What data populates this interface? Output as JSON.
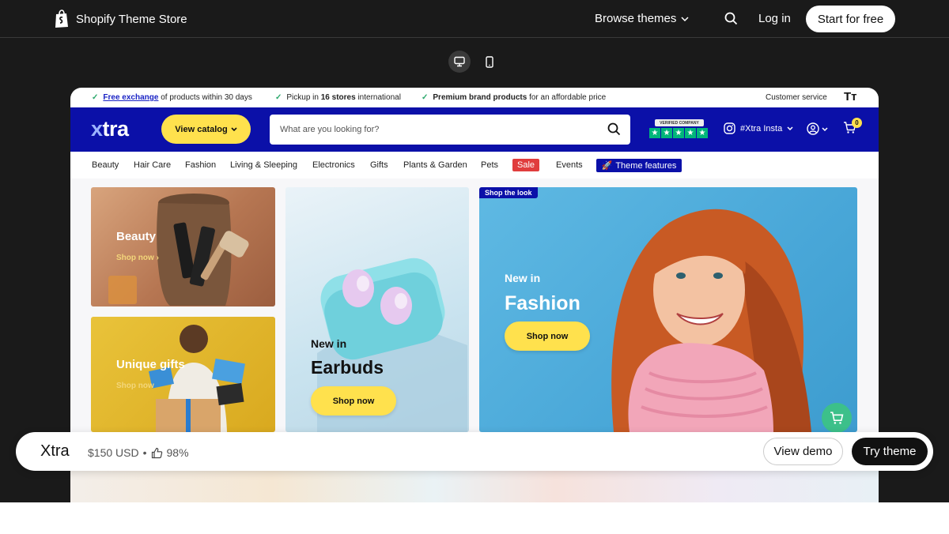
{
  "store": {
    "logo_text": "Shopify Theme Store",
    "browse_label": "Browse themes",
    "login_label": "Log in",
    "start_label": "Start for free"
  },
  "announcement": {
    "item1_link": "Free exchange",
    "item1_rest": "of products within 30 days",
    "item2_pre": "Pickup in",
    "item2_bold": "16 stores",
    "item2_rest": "international",
    "item3_bold": "Premium brand products",
    "item3_rest": "for an affordable price",
    "customer_service": "Customer service",
    "text_size_icon": "Tт"
  },
  "xtra_header": {
    "logo_x": "x",
    "logo_rest": "tra",
    "catalog_label": "View catalog",
    "search_placeholder": "What are you looking for?",
    "trust_label": "VERIFIED COMPANY",
    "insta_label": "#Xtra Insta",
    "cart_count": "0"
  },
  "nav": {
    "items": [
      "Beauty",
      "Hair Care",
      "Fashion",
      "Living & Sleeping",
      "Electronics",
      "Gifts",
      "Plants & Garden",
      "Pets"
    ],
    "sale": "Sale",
    "events": "Events",
    "features": "Theme features"
  },
  "tiles": {
    "beauty": {
      "title": "Beauty",
      "link": "Shop now"
    },
    "gifts": {
      "title": "Unique gifts",
      "link": "Shop now"
    },
    "earbuds": {
      "kicker": "New in",
      "title": "Earbuds",
      "button": "Shop now"
    },
    "fashion": {
      "badge": "Shop the look",
      "kicker": "New in",
      "title": "Fashion",
      "button": "Shop now"
    }
  },
  "theme_info": {
    "name": "Xtra",
    "price": "$150 USD",
    "separator": "•",
    "rating": "98%",
    "view_demo": "View demo",
    "try_theme": "Try theme"
  },
  "colors": {
    "brand_blue": "#0b10a8",
    "accent_yellow": "#ffe14d",
    "sale_red": "#e03d3d",
    "check_green": "#2aa86b"
  }
}
